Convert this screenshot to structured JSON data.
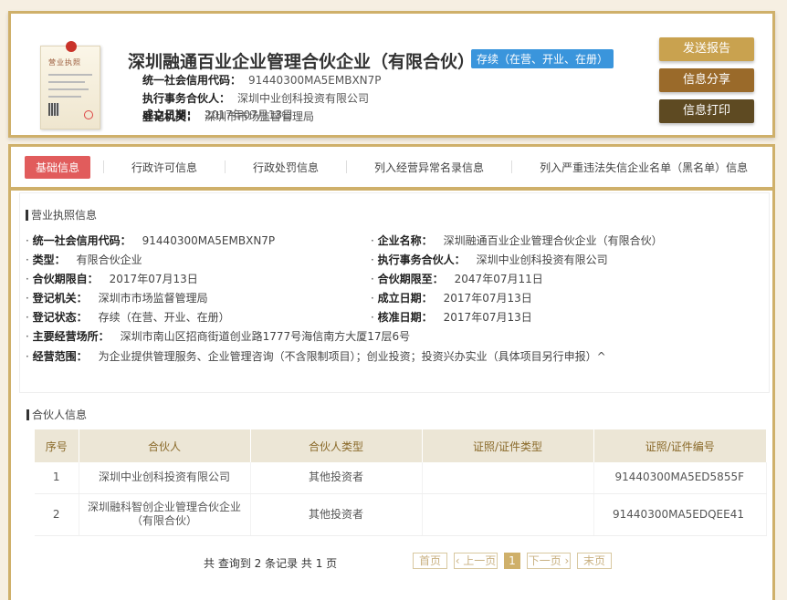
{
  "header": {
    "license_label": "营业执照",
    "company_name": "深圳融通百业企业管理合伙企业（有限合伙）",
    "status_badge": "存续（在营、开业、在册）",
    "fields": [
      {
        "label": "统一社会信用代码：",
        "value": "91440300MA5EMBXN7P"
      },
      {
        "label": "执行事务合伙人：",
        "value": "深圳中业创科投资有限公司"
      },
      {
        "label": "登记机关：",
        "value": "深圳市市场监督管理局"
      },
      {
        "label": "成立日期：",
        "value": "2017年07月13日"
      }
    ],
    "buttons": {
      "send_report": "发送报告",
      "share": "信息分享",
      "print": "信息打印"
    }
  },
  "colors": {
    "gold": "#cfb06a",
    "badge": "#3a95dc",
    "active_tab": "#e15c5c",
    "btn1": "#c9a24f",
    "btn2": "#9a6a2a",
    "btn3": "#5e4a22"
  },
  "tabs": [
    "基础信息",
    "行政许可信息",
    "行政处罚信息",
    "列入经营异常名录信息",
    "列入严重违法失信企业名单（黑名单）信息"
  ],
  "license_section": {
    "title": "营业执照信息",
    "left": [
      {
        "label": "统一社会信用代码：",
        "value": "91440300MA5EMBXN7P"
      },
      {
        "label": "类型：",
        "value": "有限合伙企业"
      },
      {
        "label": "合伙期限自：",
        "value": "2017年07月13日"
      },
      {
        "label": "登记机关：",
        "value": "深圳市市场监督管理局"
      },
      {
        "label": "登记状态：",
        "value": "存续（在营、开业、在册）"
      }
    ],
    "right": [
      {
        "label": "企业名称：",
        "value": "深圳融通百业企业管理合伙企业（有限合伙）"
      },
      {
        "label": "执行事务合伙人：",
        "value": "深圳中业创科投资有限公司"
      },
      {
        "label": "合伙期限至：",
        "value": "2047年07月11日"
      },
      {
        "label": "成立日期：",
        "value": "2017年07月13日"
      },
      {
        "label": "核准日期：",
        "value": "2017年07月13日"
      }
    ],
    "address": {
      "label": "主要经营场所：",
      "value": "深圳市南山区招商街道创业路1777号海信南方大厦17层6号"
    },
    "scope": {
      "label": "经营范围：",
      "value": "为企业提供管理服务、企业管理咨询（不含限制项目）；创业投资；投资兴办实业（具体项目另行申报）^"
    }
  },
  "partner_section": {
    "title": "合伙人信息",
    "columns": [
      "序号",
      "合伙人",
      "合伙人类型",
      "证照/证件类型",
      "证照/证件编号"
    ],
    "rows": [
      [
        "1",
        "深圳中业创科投资有限公司",
        "其他投资者",
        "",
        "91440300MA5ED5855F"
      ],
      [
        "2",
        "深圳融科智创企业管理合伙企业（有限合伙）",
        "其他投资者",
        "",
        "91440300MA5EDQEE41"
      ]
    ],
    "pagination": {
      "summary": "共 查询到 2 条记录 共 1 页",
      "first": "首页",
      "prev": "‹ 上一页",
      "current": "1",
      "next": "下一页 ›",
      "last": "末页"
    }
  }
}
